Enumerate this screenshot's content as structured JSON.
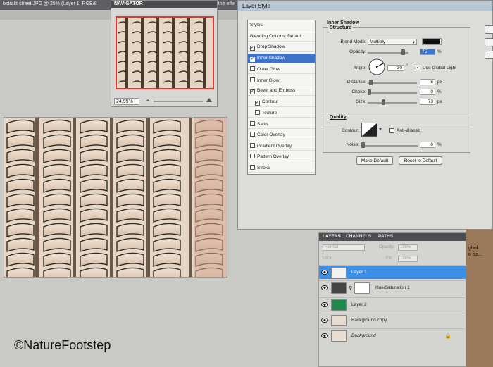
{
  "document": {
    "tab_title": "bstrakt street.JPG @ 25% (Layer 1, RGB/8",
    "tab_tail": "th the effe"
  },
  "navigator": {
    "title": "NAVIGATOR",
    "zoom": "24.95%"
  },
  "layer_style": {
    "title": "Layer Style",
    "styles": [
      {
        "label": "Styles",
        "checkbox": false,
        "checked": false
      },
      {
        "label": "Blending Options: Default",
        "checkbox": false,
        "checked": false
      },
      {
        "label": "Drop Shadow",
        "checkbox": true,
        "checked": true
      },
      {
        "label": "Inner Shadow",
        "checkbox": true,
        "checked": true,
        "selected": true
      },
      {
        "label": "Outer Glow",
        "checkbox": true,
        "checked": false
      },
      {
        "label": "Inner Glow",
        "checkbox": true,
        "checked": false
      },
      {
        "label": "Bevel and Emboss",
        "checkbox": true,
        "checked": true
      },
      {
        "label": "Contour",
        "checkbox": true,
        "checked": true,
        "indent": true
      },
      {
        "label": "Texture",
        "checkbox": true,
        "checked": false,
        "indent": true
      },
      {
        "label": "Satin",
        "checkbox": true,
        "checked": false
      },
      {
        "label": "Color Overlay",
        "checkbox": true,
        "checked": false
      },
      {
        "label": "Gradient Overlay",
        "checkbox": true,
        "checked": false
      },
      {
        "label": "Pattern Overlay",
        "checkbox": true,
        "checked": false
      },
      {
        "label": "Stroke",
        "checkbox": true,
        "checked": false
      }
    ],
    "inner_shadow": {
      "title": "Inner Shadow",
      "structure_title": "Structure",
      "blend_mode_label": "Blend Mode:",
      "blend_mode": "Multiply",
      "shadow_color": "#111111",
      "opacity_label": "Opacity:",
      "opacity": "75",
      "angle_label": "Angle:",
      "angle": "30",
      "use_global_light": "Use Global Light",
      "distance_label": "Distance:",
      "distance": "5",
      "choke_label": "Choke:",
      "choke": "0",
      "size_label": "Size:",
      "size": "73",
      "quality_title": "Quality",
      "contour_label": "Contour:",
      "anti_aliased": "Anti-aliased",
      "noise_label": "Noise:",
      "noise": "0",
      "make_default": "Make Default",
      "reset_to_default": "Reset to Default",
      "unit_px": "px",
      "unit_pct": "%",
      "unit_deg": "°"
    }
  },
  "layers_panel": {
    "tabs": [
      "LAYERS",
      "CHANNELS",
      "PATHS"
    ],
    "blend_mode": "Normal",
    "opacity_label": "Opacity:",
    "opacity": "100%",
    "lock_label": "Lock:",
    "fill_label": "Fill:",
    "fill": "100%",
    "layers": [
      {
        "name": "Layer 1",
        "selected": true
      },
      {
        "name": "Hue/Saturation 1",
        "selected": false
      },
      {
        "name": "Layer 2",
        "selected": false
      },
      {
        "name": "Background copy",
        "selected": false
      },
      {
        "name": "Background",
        "selected": false
      }
    ]
  },
  "right_strip": {
    "line1": "gbok",
    "line2": "o fra..."
  },
  "watermark": "©NatureFootstep"
}
